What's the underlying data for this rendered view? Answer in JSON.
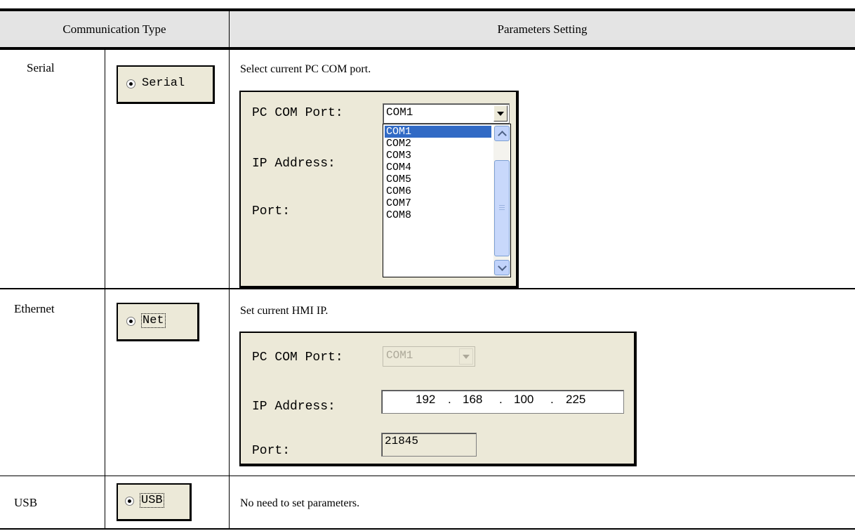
{
  "table": {
    "headers": [
      "Communication Type",
      "Parameters Setting"
    ],
    "rows": [
      {
        "type": "Serial",
        "option_label": "Serial",
        "description": "Select current PC COM port.",
        "panel": {
          "com_label": "PC COM Port:",
          "com_value": "COM1",
          "ip_label": "IP Address:",
          "port_label": "Port:",
          "dropdown_items": [
            "COM1",
            "COM2",
            "COM3",
            "COM4",
            "COM5",
            "COM6",
            "COM7",
            "COM8"
          ],
          "selected_item": "COM1"
        }
      },
      {
        "type": "Ethernet",
        "option_label": "Net",
        "description": "Set current HMI IP.",
        "panel": {
          "com_label": "PC COM Port:",
          "com_value": "COM1",
          "ip_label": "IP Address:",
          "ip_octets": [
            "192",
            "168",
            "100",
            "225"
          ],
          "port_label": "Port:",
          "port_value": "21845"
        }
      },
      {
        "type": "USB",
        "option_label": "USB",
        "description": "No need to set parameters."
      }
    ]
  },
  "colors": {
    "header_bg": "#e4e4e4",
    "dialog_bg": "#ece9d8",
    "selection": "#316ac5",
    "scrollbar": "#c1d3fb"
  }
}
